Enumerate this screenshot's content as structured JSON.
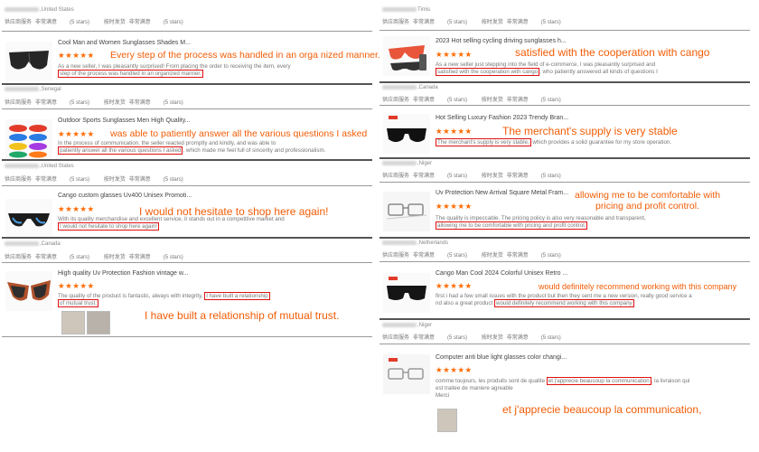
{
  "left": {
    "reviews": [
      {
        "reviewer": ",United States",
        "meta": {
          "service_label": "供应商服务",
          "service_value": "非常满意",
          "stars_count": "(5 stars)",
          "shipping_label": "按时发货",
          "shipping_value": "非常满意",
          "shipping_stars": "(5 stars)"
        },
        "product_title": "Cool Man and Women Sunglasses Shades M...",
        "stars": "★★★★★",
        "callout": "Every step of the process was handled in an orga  nized manner.",
        "body_1": "As a new seller, I was pleasantly surprised! From placing the order to receiving the item, every",
        "body_highlight": "step of the process was handled in an organized manner."
      },
      {
        "reviewer": ",Senegal",
        "meta": {
          "service_label": "供应商服务",
          "service_value": "非常满意",
          "stars_count": "(5 stars)",
          "shipping_label": "按时发货",
          "shipping_value": "非常满意",
          "shipping_stars": "(5 stars)"
        },
        "product_title": "Outdoor Sports Sunglasses Men High Quality...",
        "stars": "★★★★★",
        "callout": "was able to patiently answer all the various questions I asked",
        "body_1": "In the process of communication, the seller reacted promptly and kindly, and was able to",
        "body_highlight": "patiently answer all the various questions I asked",
        "body_2": ", which made me feel full of sincerity and professionalism."
      },
      {
        "reviewer": ",United States",
        "meta": {
          "service_label": "供应商服务",
          "service_value": "非常满意",
          "stars_count": "(5 stars)",
          "shipping_label": "按时发货",
          "shipping_value": "非常满意",
          "shipping_stars": "(5 stars)"
        },
        "product_title": "Cango custom glasses Uv400 Unisex Promoti...",
        "stars": "★★★★★",
        "callout": "I would not hesitate to shop here again!",
        "body_1": "With its quality merchandise and excellent service, it stands out in a competitive market and",
        "body_highlight": "I would not hesitate to shop here again!"
      },
      {
        "reviewer": ",Canada",
        "meta": {
          "service_label": "供应商服务",
          "service_value": "非常满意",
          "stars_count": "(5 stars)",
          "shipping_label": "按时发货",
          "shipping_value": "非常满意",
          "shipping_stars": "(5 stars)"
        },
        "product_title": "High quality Uv Protection Fashion vintage w...",
        "stars": "★★★★★",
        "callout": "I have built a relationship of mutual trust.",
        "body_1": "The quality of the product is fantastic, always with integrity,",
        "body_highlight": "I have built a relationship",
        "body_highlight_2": "of mutual trust."
      }
    ]
  },
  "right": {
    "reviews": [
      {
        "reviewer": "Timis",
        "meta": {
          "service_label": "供应商服务",
          "service_value": "非常满意",
          "stars_count": "(5 stars)",
          "shipping_label": "按时发货",
          "shipping_value": "非常满意",
          "shipping_stars": "(5 stars)"
        },
        "product_title": "2023 Hot selling cycling driving sunglasses h...",
        "stars": "★★★★★",
        "callout": "satisfied with the cooperation with cango",
        "body_1": "As a new seller just stepping into the field of e-commerce, I was pleasantly surprised and",
        "body_highlight": "satisfied with the cooperation with cango",
        "body_2": ", who patiently answered all kinds of questions I"
      },
      {
        "reviewer": ",Canada",
        "meta": {
          "service_label": "供应商服务",
          "service_value": "非常满意",
          "stars_count": "(5 stars)",
          "shipping_label": "按时发货",
          "shipping_value": "非常满意",
          "shipping_stars": "(5 stars)"
        },
        "product_title": "Hot Selling Luxury Fashion 2023 Trendy Bran...",
        "stars": "★★★★★",
        "callout": "The merchant's supply is very stable",
        "body_highlight": "The merchant's supply is very stable,",
        "body_2": " which provides a solid guarantee for my store operation."
      },
      {
        "reviewer": ",Niger",
        "meta": {
          "service_label": "供应商服务",
          "service_value": "非常满意",
          "stars_count": "(5 stars)",
          "shipping_label": "按时发货",
          "shipping_value": "非常满意",
          "shipping_stars": "(5 stars)"
        },
        "product_title": "Uv Protection New Arrival Square Metal Fram...",
        "stars": "★★★★★",
        "callout_1": "allowing me to be comfortable with",
        "callout_2": "pricing and profit control.",
        "body_1": "The quality is impeccable. The pricing policy is also very reasonable and transparent,",
        "body_highlight": "allowing me to be comfortable with pricing and profit control."
      },
      {
        "reviewer": ",Netherlands",
        "meta": {
          "service_label": "供应商服务",
          "service_value": "非常满意",
          "stars_count": "(5 stars)",
          "shipping_label": "按时发货",
          "shipping_value": "非常满意",
          "shipping_stars": "(5 stars)"
        },
        "product_title": "Cango Man Cool 2024 Colorful Unisex Retro ...",
        "stars": "★★★★★",
        "callout": "would definitely recommend working with this company",
        "body_1": "first i had a few small issues with the product but then they sent me a new version, really good service a",
        "body_2": "nd also a great product ",
        "body_highlight": "would definitely recommend working with this company"
      },
      {
        "reviewer": ",Niger",
        "meta": {
          "service_label": "供应商服务",
          "service_value": "非常满意",
          "stars_count": "(5 stars)",
          "shipping_label": "按时发货",
          "shipping_value": "非常满意",
          "shipping_stars": "(5 stars)"
        },
        "product_title": "Computer anti blue light glasses color changi...",
        "stars": "★★★★★",
        "callout": "et j'apprecie beaucoup la communication,",
        "body_1": "comme toujours, les produits sont de qualite ",
        "body_highlight": "et j'apprecie beaucoup la communication",
        "body_2": ", la livraison qui",
        "body_3": "est traitee de maniere agreable",
        "body_4": "Merci"
      }
    ]
  },
  "colors": {
    "accent": "#f25c05",
    "highlight_box": "#e01010",
    "stars": "#ff6a00"
  }
}
